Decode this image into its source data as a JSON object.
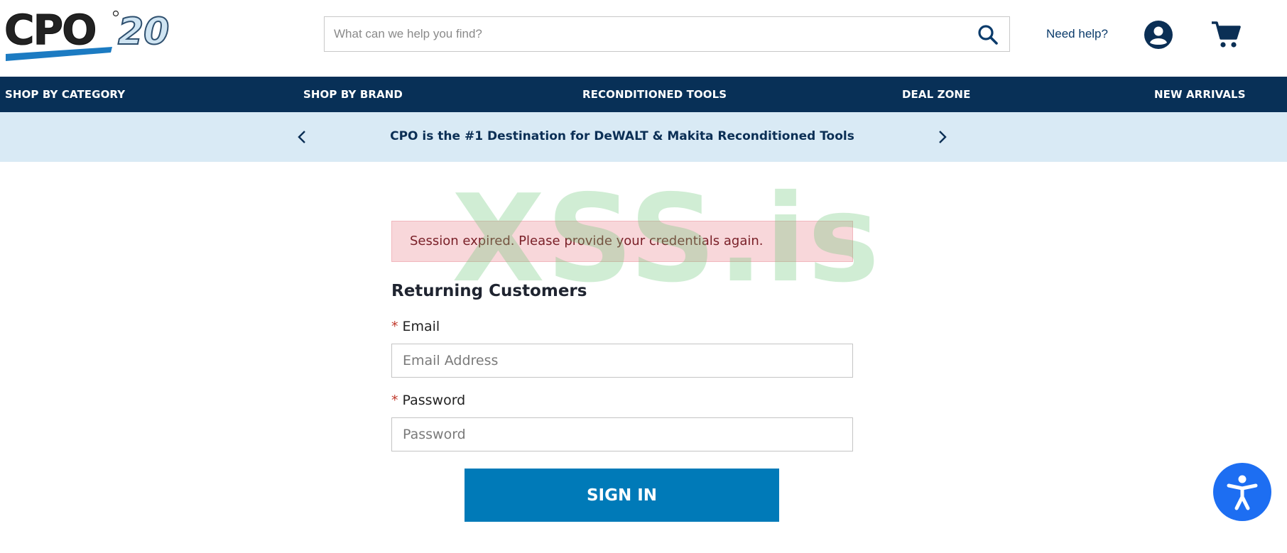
{
  "header": {
    "logo_text": "CPO",
    "logo_number": "20",
    "search_placeholder": "What can we help you find?",
    "need_help": "Need help?"
  },
  "nav": {
    "items": [
      {
        "label": "SHOP BY CATEGORY"
      },
      {
        "label": "SHOP BY BRAND"
      },
      {
        "label": "RECONDITIONED TOOLS"
      },
      {
        "label": "DEAL ZONE"
      },
      {
        "label": "NEW ARRIVALS"
      }
    ]
  },
  "promo": {
    "text": "CPO is the #1 Destination for DeWALT & Makita Reconditioned Tools"
  },
  "watermark": "XSS.is",
  "login": {
    "alert": "Session expired. Please provide your credentials again.",
    "title": "Returning Customers",
    "required_mark": "*",
    "email_label": "Email",
    "email_placeholder": "Email Address",
    "password_label": "Password",
    "password_placeholder": "Password",
    "submit": "SIGN IN"
  },
  "colors": {
    "nav_bg": "#083057",
    "promo_bg": "#d9eaf5",
    "button": "#007ab8",
    "alert_bg": "#f8d7da",
    "accessibility": "#1d6ef2"
  },
  "icons": {
    "search": "search-icon",
    "account": "user-circle-icon",
    "cart": "cart-icon",
    "prev": "chevron-left-icon",
    "next": "chevron-right-icon",
    "accessibility": "accessibility-icon"
  }
}
